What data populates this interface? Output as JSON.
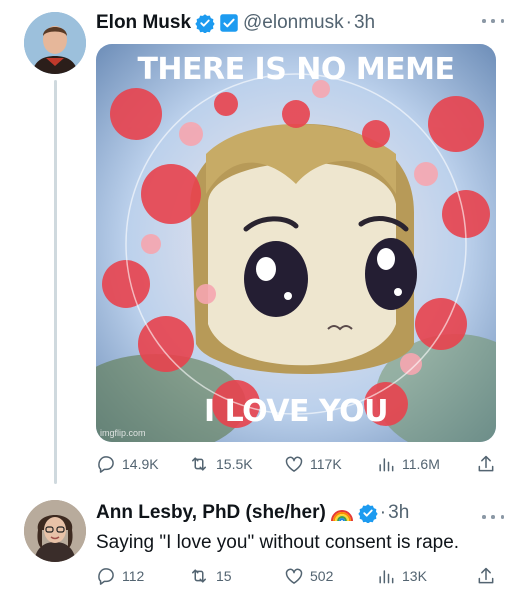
{
  "tweet1": {
    "author_name": "Elon Musk",
    "handle": "@elonmusk",
    "separator": "·",
    "time": "3h",
    "meme": {
      "top_text": "THERE IS NO MEME",
      "bottom_text": "I LOVE YOU",
      "watermark": "imgflip.com"
    },
    "stats": {
      "replies": "14.9K",
      "reposts": "15.5K",
      "likes": "117K",
      "views": "11.6M"
    }
  },
  "tweet2": {
    "author_name": "Ann Lesby, PhD (she/her)",
    "separator": "·",
    "time": "3h",
    "text": "Saying \"I love you\" without consent is rape.",
    "stats": {
      "replies": "112",
      "reposts": "15",
      "likes": "502",
      "views": "13K"
    }
  },
  "icons": [
    "verified-badge-icon",
    "government-badge-icon",
    "more-icon",
    "reply-icon",
    "repost-icon",
    "like-icon",
    "views-icon",
    "share-icon",
    "rainbow-icon"
  ],
  "colors": {
    "verified_blue": "#1d9bf0",
    "text_primary": "#0f1419",
    "text_secondary": "#536471",
    "thread_line": "#cfd9de"
  }
}
